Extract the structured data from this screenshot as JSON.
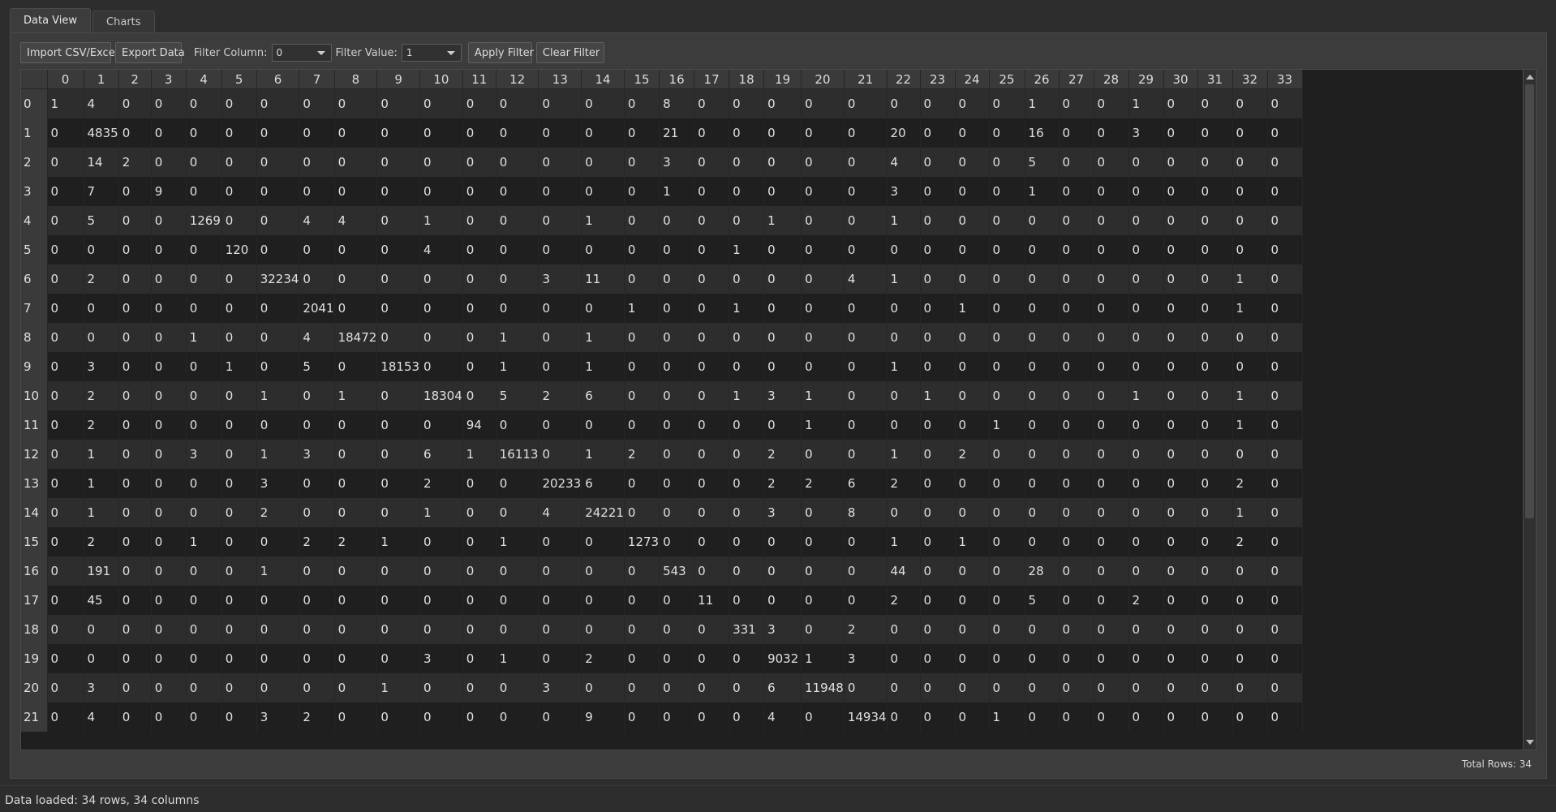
{
  "tabs": [
    {
      "label": "Data View",
      "active": true
    },
    {
      "label": "Charts",
      "active": false
    }
  ],
  "toolbar": {
    "import_label": "Import CSV/Excel",
    "export_label": "Export Data",
    "filter_column_label": "Filter Column:",
    "filter_column_value": "0",
    "filter_value_label": "Filter Value:",
    "filter_value_value": "1",
    "apply_label": "Apply Filter",
    "clear_label": "Clear Filter"
  },
  "table": {
    "columns": [
      "0",
      "1",
      "2",
      "3",
      "4",
      "5",
      "6",
      "7",
      "8",
      "9",
      "10",
      "11",
      "12",
      "13",
      "14",
      "15",
      "16",
      "17",
      "18",
      "19",
      "20",
      "21",
      "22",
      "23",
      "24",
      "25",
      "26",
      "27",
      "28",
      "29",
      "30",
      "31",
      "32",
      "33"
    ],
    "rows": [
      [
        "0",
        [
          "1",
          "4",
          "0",
          "0",
          "0",
          "0",
          "0",
          "0",
          "0",
          "0",
          "0",
          "0",
          "0",
          "0",
          "0",
          "0",
          "8",
          "0",
          "0",
          "0",
          "0",
          "0",
          "0",
          "0",
          "0",
          "0",
          "1",
          "0",
          "0",
          "1",
          "0",
          "0",
          "0",
          "0"
        ]
      ],
      [
        "1",
        [
          "0",
          "4835",
          "0",
          "0",
          "0",
          "0",
          "0",
          "0",
          "0",
          "0",
          "0",
          "0",
          "0",
          "0",
          "0",
          "0",
          "21",
          "0",
          "0",
          "0",
          "0",
          "0",
          "20",
          "0",
          "0",
          "0",
          "16",
          "0",
          "0",
          "3",
          "0",
          "0",
          "0",
          "0"
        ]
      ],
      [
        "2",
        [
          "0",
          "14",
          "2",
          "0",
          "0",
          "0",
          "0",
          "0",
          "0",
          "0",
          "0",
          "0",
          "0",
          "0",
          "0",
          "0",
          "3",
          "0",
          "0",
          "0",
          "0",
          "0",
          "4",
          "0",
          "0",
          "0",
          "5",
          "0",
          "0",
          "0",
          "0",
          "0",
          "0",
          "0"
        ]
      ],
      [
        "3",
        [
          "0",
          "7",
          "0",
          "9",
          "0",
          "0",
          "0",
          "0",
          "0",
          "0",
          "0",
          "0",
          "0",
          "0",
          "0",
          "0",
          "1",
          "0",
          "0",
          "0",
          "0",
          "0",
          "3",
          "0",
          "0",
          "0",
          "1",
          "0",
          "0",
          "0",
          "0",
          "0",
          "0",
          "0"
        ]
      ],
      [
        "4",
        [
          "0",
          "5",
          "0",
          "0",
          "1269",
          "0",
          "0",
          "4",
          "4",
          "0",
          "1",
          "0",
          "0",
          "0",
          "1",
          "0",
          "0",
          "0",
          "0",
          "1",
          "0",
          "0",
          "1",
          "0",
          "0",
          "0",
          "0",
          "0",
          "0",
          "0",
          "0",
          "0",
          "0",
          "0"
        ]
      ],
      [
        "5",
        [
          "0",
          "0",
          "0",
          "0",
          "0",
          "120",
          "0",
          "0",
          "0",
          "0",
          "4",
          "0",
          "0",
          "0",
          "0",
          "0",
          "0",
          "0",
          "1",
          "0",
          "0",
          "0",
          "0",
          "0",
          "0",
          "0",
          "0",
          "0",
          "0",
          "0",
          "0",
          "0",
          "0",
          "0"
        ]
      ],
      [
        "6",
        [
          "0",
          "2",
          "0",
          "0",
          "0",
          "0",
          "32234",
          "0",
          "0",
          "0",
          "0",
          "0",
          "0",
          "3",
          "11",
          "0",
          "0",
          "0",
          "0",
          "0",
          "0",
          "4",
          "1",
          "0",
          "0",
          "0",
          "0",
          "0",
          "0",
          "0",
          "0",
          "0",
          "1",
          "0"
        ]
      ],
      [
        "7",
        [
          "0",
          "0",
          "0",
          "0",
          "0",
          "0",
          "0",
          "2041",
          "0",
          "0",
          "0",
          "0",
          "0",
          "0",
          "0",
          "1",
          "0",
          "0",
          "1",
          "0",
          "0",
          "0",
          "0",
          "0",
          "1",
          "0",
          "0",
          "0",
          "0",
          "0",
          "0",
          "0",
          "1",
          "0"
        ]
      ],
      [
        "8",
        [
          "0",
          "0",
          "0",
          "0",
          "1",
          "0",
          "0",
          "4",
          "18472",
          "0",
          "0",
          "0",
          "1",
          "0",
          "1",
          "0",
          "0",
          "0",
          "0",
          "0",
          "0",
          "0",
          "0",
          "0",
          "0",
          "0",
          "0",
          "0",
          "0",
          "0",
          "0",
          "0",
          "0",
          "0"
        ]
      ],
      [
        "9",
        [
          "0",
          "3",
          "0",
          "0",
          "0",
          "1",
          "0",
          "5",
          "0",
          "18153",
          "0",
          "0",
          "1",
          "0",
          "1",
          "0",
          "0",
          "0",
          "0",
          "0",
          "0",
          "0",
          "1",
          "0",
          "0",
          "0",
          "0",
          "0",
          "0",
          "0",
          "0",
          "0",
          "0",
          "0"
        ]
      ],
      [
        "10",
        [
          "0",
          "2",
          "0",
          "0",
          "0",
          "0",
          "1",
          "0",
          "1",
          "0",
          "18304",
          "0",
          "5",
          "2",
          "6",
          "0",
          "0",
          "0",
          "1",
          "3",
          "1",
          "0",
          "0",
          "1",
          "0",
          "0",
          "0",
          "0",
          "0",
          "1",
          "0",
          "0",
          "1",
          "0"
        ]
      ],
      [
        "11",
        [
          "0",
          "2",
          "0",
          "0",
          "0",
          "0",
          "0",
          "0",
          "0",
          "0",
          "0",
          "94",
          "0",
          "0",
          "0",
          "0",
          "0",
          "0",
          "0",
          "0",
          "1",
          "0",
          "0",
          "0",
          "0",
          "1",
          "0",
          "0",
          "0",
          "0",
          "0",
          "0",
          "1",
          "0"
        ]
      ],
      [
        "12",
        [
          "0",
          "1",
          "0",
          "0",
          "3",
          "0",
          "1",
          "3",
          "0",
          "0",
          "6",
          "1",
          "16113",
          "0",
          "1",
          "2",
          "0",
          "0",
          "0",
          "2",
          "0",
          "0",
          "1",
          "0",
          "2",
          "0",
          "0",
          "0",
          "0",
          "0",
          "0",
          "0",
          "0",
          "0"
        ]
      ],
      [
        "13",
        [
          "0",
          "1",
          "0",
          "0",
          "0",
          "0",
          "3",
          "0",
          "0",
          "0",
          "2",
          "0",
          "0",
          "20233",
          "6",
          "0",
          "0",
          "0",
          "0",
          "2",
          "2",
          "6",
          "2",
          "0",
          "0",
          "0",
          "0",
          "0",
          "0",
          "0",
          "0",
          "0",
          "2",
          "0"
        ]
      ],
      [
        "14",
        [
          "0",
          "1",
          "0",
          "0",
          "0",
          "0",
          "2",
          "0",
          "0",
          "0",
          "1",
          "0",
          "0",
          "4",
          "24221",
          "0",
          "0",
          "0",
          "0",
          "3",
          "0",
          "8",
          "0",
          "0",
          "0",
          "0",
          "0",
          "0",
          "0",
          "0",
          "0",
          "0",
          "1",
          "0"
        ]
      ],
      [
        "15",
        [
          "0",
          "2",
          "0",
          "0",
          "1",
          "0",
          "0",
          "2",
          "2",
          "1",
          "0",
          "0",
          "1",
          "0",
          "0",
          "1273",
          "0",
          "0",
          "0",
          "0",
          "0",
          "0",
          "1",
          "0",
          "1",
          "0",
          "0",
          "0",
          "0",
          "0",
          "0",
          "0",
          "2",
          "0"
        ]
      ],
      [
        "16",
        [
          "0",
          "191",
          "0",
          "0",
          "0",
          "0",
          "1",
          "0",
          "0",
          "0",
          "0",
          "0",
          "0",
          "0",
          "0",
          "0",
          "543",
          "0",
          "0",
          "0",
          "0",
          "0",
          "44",
          "0",
          "0",
          "0",
          "28",
          "0",
          "0",
          "0",
          "0",
          "0",
          "0",
          "0"
        ]
      ],
      [
        "17",
        [
          "0",
          "45",
          "0",
          "0",
          "0",
          "0",
          "0",
          "0",
          "0",
          "0",
          "0",
          "0",
          "0",
          "0",
          "0",
          "0",
          "0",
          "11",
          "0",
          "0",
          "0",
          "0",
          "2",
          "0",
          "0",
          "0",
          "5",
          "0",
          "0",
          "2",
          "0",
          "0",
          "0",
          "0"
        ]
      ],
      [
        "18",
        [
          "0",
          "0",
          "0",
          "0",
          "0",
          "0",
          "0",
          "0",
          "0",
          "0",
          "0",
          "0",
          "0",
          "0",
          "0",
          "0",
          "0",
          "0",
          "331",
          "3",
          "0",
          "2",
          "0",
          "0",
          "0",
          "0",
          "0",
          "0",
          "0",
          "0",
          "0",
          "0",
          "0",
          "0"
        ]
      ],
      [
        "19",
        [
          "0",
          "0",
          "0",
          "0",
          "0",
          "0",
          "0",
          "0",
          "0",
          "0",
          "3",
          "0",
          "1",
          "0",
          "2",
          "0",
          "0",
          "0",
          "0",
          "9032",
          "1",
          "3",
          "0",
          "0",
          "0",
          "0",
          "0",
          "0",
          "0",
          "0",
          "0",
          "0",
          "0",
          "0"
        ]
      ],
      [
        "20",
        [
          "0",
          "3",
          "0",
          "0",
          "0",
          "0",
          "0",
          "0",
          "0",
          "1",
          "0",
          "0",
          "0",
          "3",
          "0",
          "0",
          "0",
          "0",
          "0",
          "6",
          "11948",
          "0",
          "0",
          "0",
          "0",
          "0",
          "0",
          "0",
          "0",
          "0",
          "0",
          "0",
          "0",
          "0"
        ]
      ],
      [
        "21",
        [
          "0",
          "4",
          "0",
          "0",
          "0",
          "0",
          "3",
          "2",
          "0",
          "0",
          "0",
          "0",
          "0",
          "0",
          "9",
          "0",
          "0",
          "0",
          "0",
          "4",
          "0",
          "14934",
          "0",
          "0",
          "0",
          "1",
          "0",
          "0",
          "0",
          "0",
          "0",
          "0",
          "0",
          "0"
        ]
      ]
    ]
  },
  "footer": {
    "total_rows": "Total Rows: 34"
  },
  "status_bar": {
    "message": "Data loaded: 34 rows, 34 columns"
  }
}
